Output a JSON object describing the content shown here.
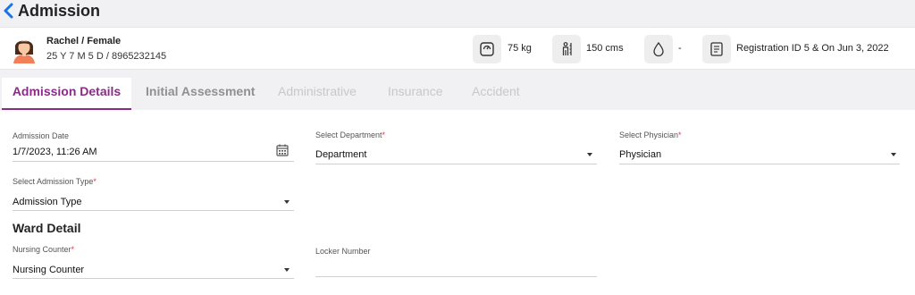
{
  "header": {
    "title": "Admission"
  },
  "patient": {
    "name_gender": "Rachel / Female",
    "age_phone": "25 Y 7 M 5 D / 8965232145",
    "weight": "75 kg",
    "height": "150 cms",
    "blood_group": "-",
    "registration": "Registration ID 5 & On Jun 3, 2022"
  },
  "tabs": [
    {
      "label": "Admission Details"
    },
    {
      "label": "Initial Assessment"
    },
    {
      "label": "Administrative"
    },
    {
      "label": "Insurance"
    },
    {
      "label": "Accident"
    }
  ],
  "form": {
    "admission_date": {
      "label": "Admission Date",
      "value": "1/7/2023, 11:26 AM"
    },
    "department": {
      "label": "Select Department",
      "value": "Department"
    },
    "physician": {
      "label": "Select Physician",
      "value": "Physician"
    },
    "admission_type": {
      "label": "Select Admission Type",
      "value": "Admission Type"
    },
    "ward_section": "Ward Detail",
    "nursing_counter": {
      "label": "Nursing Counter",
      "value": "Nursing Counter"
    },
    "locker_number": {
      "label": "Locker Number",
      "value": ""
    },
    "required_mark": "*"
  },
  "colors": {
    "accent": "#8a2b87",
    "back": "#1a73e8",
    "required": "#e2384b",
    "inactive_tab": "#c7c7cd"
  }
}
